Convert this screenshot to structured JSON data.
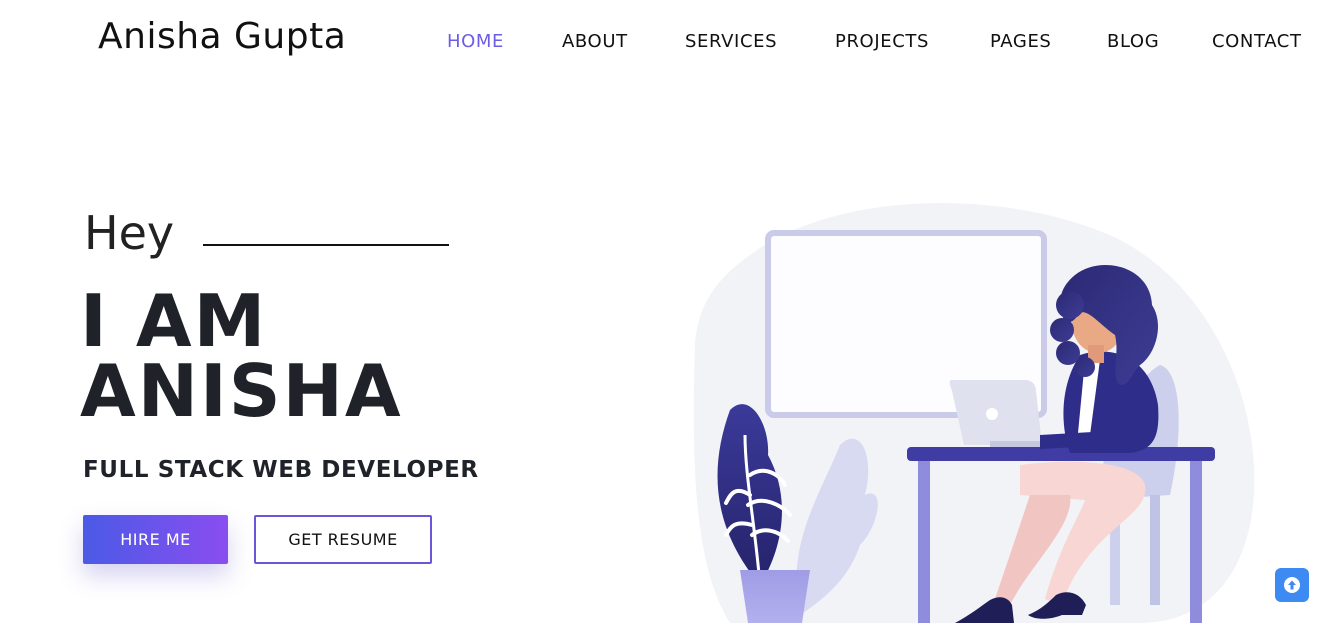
{
  "header": {
    "brand": "Anisha Gupta",
    "nav": [
      {
        "label": "HOME",
        "active": true
      },
      {
        "label": "ABOUT"
      },
      {
        "label": "SERVICES"
      },
      {
        "label": "PROJECTS"
      },
      {
        "label": "PAGES"
      },
      {
        "label": "BLOG"
      },
      {
        "label": "CONTACT"
      }
    ]
  },
  "hero": {
    "greeting": "Hey",
    "name_line1": "I AM",
    "name_line2": "ANISHA",
    "role": "FULL STACK WEB DEVELOPER",
    "hire_label": "HIRE ME",
    "resume_label": "GET RESUME"
  },
  "illustration": {
    "icon": "woman-working-at-laptop-illustration"
  },
  "scroll_top": {
    "icon": "arrow-up-icon"
  },
  "colors": {
    "accent": "#6c5ce7",
    "button_gradient_start": "#4b5ae6",
    "button_gradient_end": "#8a4df0",
    "scroll_button": "#3d8bf2"
  }
}
